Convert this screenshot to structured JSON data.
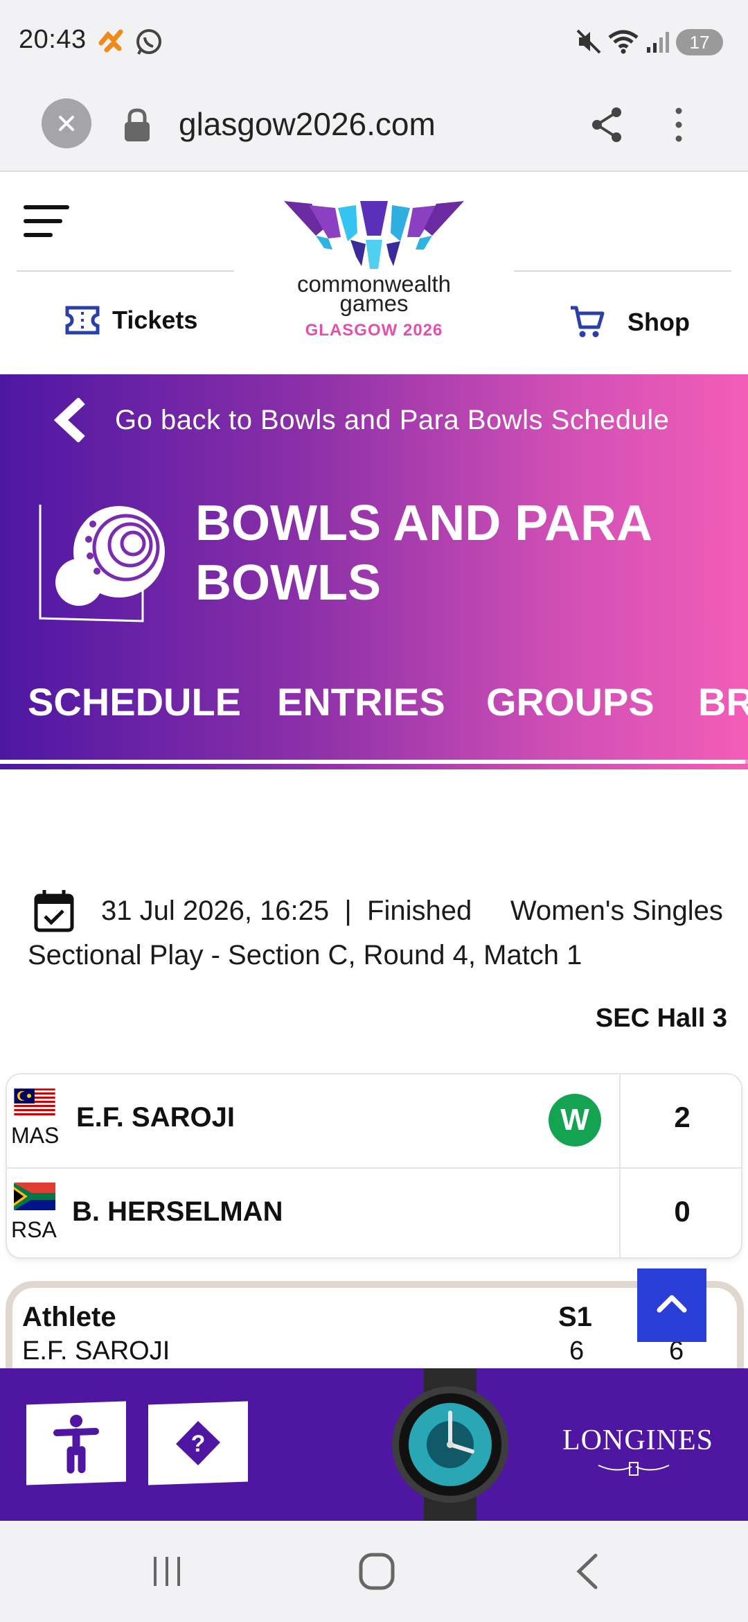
{
  "status_bar": {
    "time": "20:43",
    "battery": "17",
    "icons": [
      "app-notification-icon",
      "whatsapp-icon",
      "mute-icon",
      "wifi-icon",
      "signal-icon",
      "battery-icon"
    ]
  },
  "browser": {
    "url": "glasgow2026.com",
    "icons": [
      "close-icon",
      "lock-icon",
      "share-icon",
      "more-vert-icon"
    ]
  },
  "header": {
    "logo_line1": "commonwealth",
    "logo_line2": "games",
    "logo_line3": "GLASGOW 2026",
    "tickets_label": "Tickets",
    "shop_label": "Shop"
  },
  "hero": {
    "back_label": "Go back to Bowls and Para Bowls Schedule",
    "sport_title": "BOWLS AND PARA BOWLS",
    "tabs": [
      "SCHEDULE",
      "ENTRIES",
      "GROUPS",
      "BR"
    ]
  },
  "match": {
    "datetime": "31 Jul 2026, 16:25",
    "separator": "|",
    "status": "Finished",
    "description": "Women's Singles Sectional Play - Section C, Round 4, Match 1",
    "venue": "SEC Hall 3"
  },
  "scoreboard": {
    "players": [
      {
        "noc": "MAS",
        "name": "E.F. SAROJI",
        "badge": "W",
        "score": "2"
      },
      {
        "noc": "RSA",
        "name": "B. HERSELMAN",
        "badge": "",
        "score": "0"
      }
    ]
  },
  "results_table": {
    "headers": [
      "Athlete",
      "S1"
    ],
    "rows": [
      {
        "athlete": "E.F. SAROJI",
        "s1": "6",
        "s2": "6"
      }
    ]
  },
  "footer": {
    "sponsor": "LONGINES",
    "buttons": [
      "accessibility-icon",
      "help-icon"
    ]
  },
  "colors": {
    "hero_gradient_start": "#4d17a3",
    "hero_gradient_end": "#f35db7",
    "accent_pink": "#e24fae",
    "win_green": "#13a351",
    "footer_purple": "#4f16a2",
    "scroll_top_blue": "#2a3fd8"
  }
}
